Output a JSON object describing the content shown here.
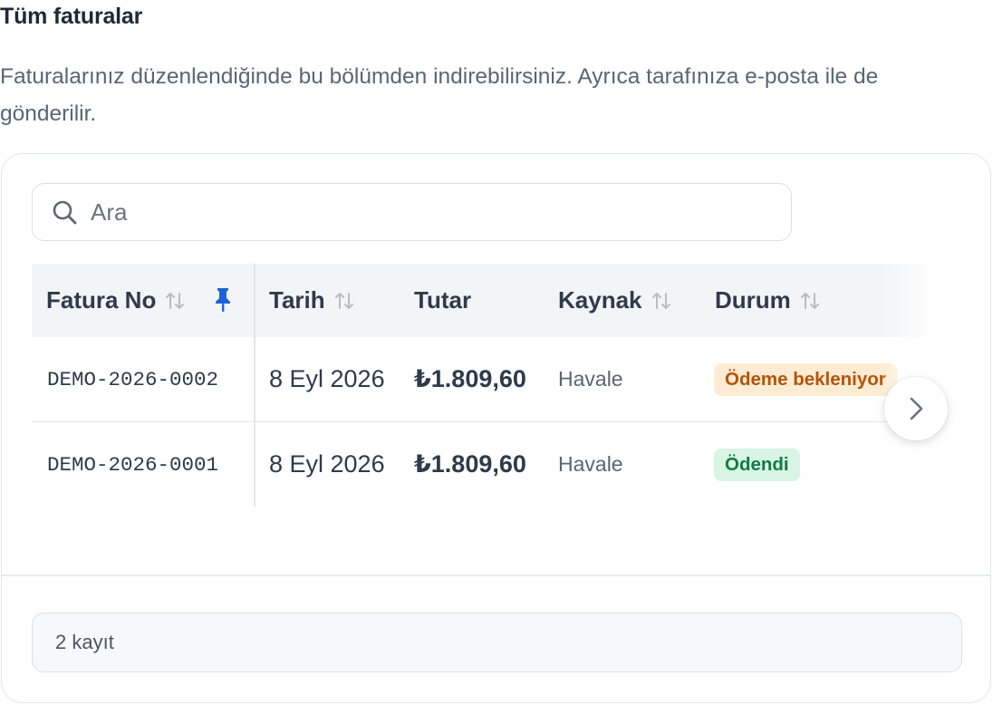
{
  "section": {
    "title": "Tüm faturalar",
    "description": "Faturalarınız düzenlendiğinde bu bölümden indirebilirsiniz. Ayrıca tarafınıza e-posta ile de gönderilir."
  },
  "search": {
    "placeholder": "Ara",
    "icon": "search-icon"
  },
  "table": {
    "columns": {
      "invoice_no": "Fatura No",
      "date": "Tarih",
      "amount": "Tutar",
      "source": "Kaynak",
      "status": "Durum"
    },
    "rows": [
      {
        "invoice_no": "DEMO-2026-0002",
        "date": "8 Eyl 2026",
        "amount": "₺1.809,60",
        "source": "Havale",
        "status": "Ödeme bekleniyor",
        "status_kind": "pending"
      },
      {
        "invoice_no": "DEMO-2026-0001",
        "date": "8 Eyl 2026",
        "amount": "₺1.809,60",
        "source": "Havale",
        "status": "Ödendi",
        "status_kind": "paid"
      }
    ]
  },
  "footer": {
    "record_count": "2 kayıt"
  },
  "colors": {
    "pin": "#1d63d6",
    "pending_bg": "#fdecd3",
    "pending_text": "#b5530b",
    "paid_bg": "#d8f4e5",
    "paid_text": "#137a46"
  }
}
